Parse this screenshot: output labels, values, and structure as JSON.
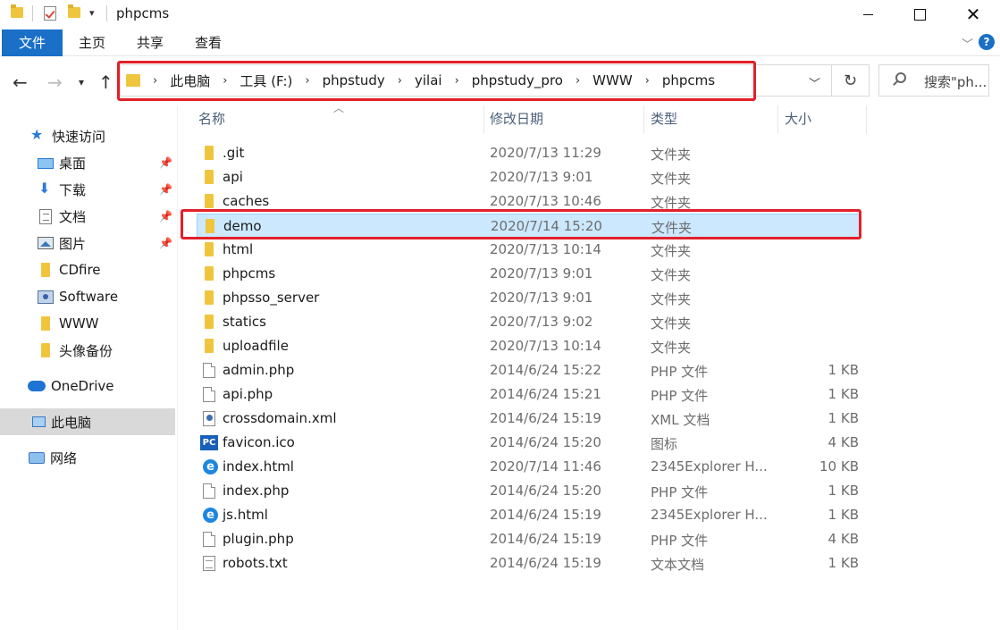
{
  "window": {
    "title": "phpcms"
  },
  "ribbon": {
    "tabs": [
      "文件",
      "主页",
      "共享",
      "查看"
    ]
  },
  "address": {
    "crumbs": [
      "此电脑",
      "工具 (F:)",
      "phpstudy",
      "yilai",
      "phpstudy_pro",
      "WWW",
      "phpcms"
    ],
    "search_placeholder": "搜索\"ph..."
  },
  "nav": {
    "quick_access": "快速访问",
    "items": [
      {
        "label": "桌面",
        "icon": "desktop-icon",
        "pinned": true
      },
      {
        "label": "下载",
        "icon": "download-icon",
        "pinned": true
      },
      {
        "label": "文档",
        "icon": "document-icon",
        "pinned": true
      },
      {
        "label": "图片",
        "icon": "pictures-icon",
        "pinned": true
      },
      {
        "label": "CDfire",
        "icon": "folder-icon",
        "pinned": false
      },
      {
        "label": "Software",
        "icon": "software-icon",
        "pinned": false
      },
      {
        "label": "WWW",
        "icon": "folder-icon",
        "pinned": false
      },
      {
        "label": "头像备份",
        "icon": "folder-icon",
        "pinned": false
      }
    ],
    "onedrive": "OneDrive",
    "this_pc": "此电脑",
    "network": "网络"
  },
  "columns": {
    "name": "名称",
    "date": "修改日期",
    "type": "类型",
    "size": "大小"
  },
  "files": [
    {
      "name": ".git",
      "date": "2020/7/13 11:29",
      "type": "文件夹",
      "size": "",
      "icon": "folder"
    },
    {
      "name": "api",
      "date": "2020/7/13 9:01",
      "type": "文件夹",
      "size": "",
      "icon": "folder"
    },
    {
      "name": "caches",
      "date": "2020/7/13 10:46",
      "type": "文件夹",
      "size": "",
      "icon": "folder"
    },
    {
      "name": "demo",
      "date": "2020/7/14 15:20",
      "type": "文件夹",
      "size": "",
      "icon": "folder",
      "selected": true
    },
    {
      "name": "html",
      "date": "2020/7/13 10:14",
      "type": "文件夹",
      "size": "",
      "icon": "folder"
    },
    {
      "name": "phpcms",
      "date": "2020/7/13 9:01",
      "type": "文件夹",
      "size": "",
      "icon": "folder"
    },
    {
      "name": "phpsso_server",
      "date": "2020/7/13 9:01",
      "type": "文件夹",
      "size": "",
      "icon": "folder"
    },
    {
      "name": "statics",
      "date": "2020/7/13 9:02",
      "type": "文件夹",
      "size": "",
      "icon": "folder"
    },
    {
      "name": "uploadfile",
      "date": "2020/7/13 10:14",
      "type": "文件夹",
      "size": "",
      "icon": "folder"
    },
    {
      "name": "admin.php",
      "date": "2014/6/24 15:22",
      "type": "PHP 文件",
      "size": "1 KB",
      "icon": "php"
    },
    {
      "name": "api.php",
      "date": "2014/6/24 15:21",
      "type": "PHP 文件",
      "size": "1 KB",
      "icon": "php"
    },
    {
      "name": "crossdomain.xml",
      "date": "2014/6/24 15:19",
      "type": "XML 文档",
      "size": "1 KB",
      "icon": "xml"
    },
    {
      "name": "favicon.ico",
      "date": "2014/6/24 15:20",
      "type": "图标",
      "size": "4 KB",
      "icon": "ico"
    },
    {
      "name": "index.html",
      "date": "2020/7/14 11:46",
      "type": "2345Explorer H...",
      "size": "10 KB",
      "icon": "ie"
    },
    {
      "name": "index.php",
      "date": "2014/6/24 15:20",
      "type": "PHP 文件",
      "size": "1 KB",
      "icon": "php"
    },
    {
      "name": "js.html",
      "date": "2014/6/24 15:19",
      "type": "2345Explorer H...",
      "size": "1 KB",
      "icon": "ie"
    },
    {
      "name": "plugin.php",
      "date": "2014/6/24 15:19",
      "type": "PHP 文件",
      "size": "4 KB",
      "icon": "php"
    },
    {
      "name": "robots.txt",
      "date": "2014/6/24 15:19",
      "type": "文本文档",
      "size": "1 KB",
      "icon": "txt"
    }
  ],
  "colors": {
    "accent": "#1a6fc7",
    "highlight_red": "#e2202a",
    "selected_row": "#cce8ff"
  }
}
